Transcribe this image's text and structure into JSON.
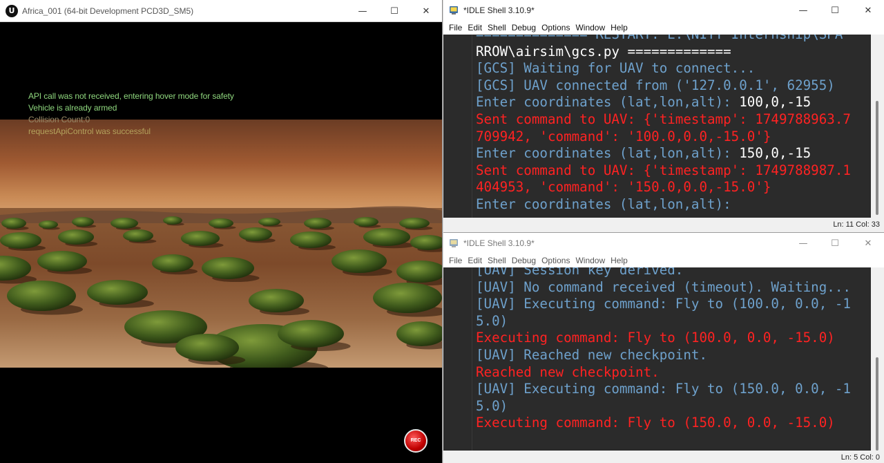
{
  "unreal": {
    "window_title": "Africa_001 (64-bit Development PCD3D_SM5)",
    "logo_glyph": "U",
    "controls": {
      "minimize": "—",
      "maximize": "☐",
      "close": "✕"
    },
    "messages": [
      "API call was not received, entering hover mode for safety",
      "Vehicle is already armed",
      "Collision Count:0",
      "requestApiControl was successful"
    ],
    "record_button_label": "REC"
  },
  "idle_top": {
    "window_title": "*IDLE Shell 3.10.9*",
    "menu": [
      "File",
      "Edit",
      "Shell",
      "Debug",
      "Options",
      "Window",
      "Help"
    ],
    "lines": [
      [
        {
          "text": "============== RESTART: E:\\NITT Internship\\SPA",
          "style": "out"
        }
      ],
      [
        {
          "text": "RROW\\airsim\\gcs.py =============",
          "style": "in"
        }
      ],
      [
        {
          "text": "[GCS] Waiting for UAV to connect...",
          "style": "out"
        }
      ],
      [
        {
          "text": "[GCS] UAV connected from ('127.0.0.1', 62955)",
          "style": "out"
        }
      ],
      [
        {
          "text": "Enter coordinates (lat,lon,alt): ",
          "style": "out"
        },
        {
          "text": "100,0,-15",
          "style": "in"
        }
      ],
      [
        {
          "text": "Sent command to UAV: {'timestamp': 1749788963.7",
          "style": "err"
        }
      ],
      [
        {
          "text": "709942, 'command': '100.0,0.0,-15.0'}",
          "style": "err"
        }
      ],
      [
        {
          "text": "Enter coordinates (lat,lon,alt): ",
          "style": "out"
        },
        {
          "text": "150,0,-15",
          "style": "in"
        }
      ],
      [
        {
          "text": "Sent command to UAV: {'timestamp': 1749788987.1",
          "style": "err"
        }
      ],
      [
        {
          "text": "404953, 'command': '150.0,0.0,-15.0'}",
          "style": "err"
        }
      ],
      [
        {
          "text": "Enter coordinates (lat,lon,alt):",
          "style": "out"
        }
      ]
    ],
    "status": "Ln: 11   Col: 33"
  },
  "idle_bottom": {
    "window_title": "*IDLE Shell 3.10.9*",
    "menu": [
      "File",
      "Edit",
      "Shell",
      "Debug",
      "Options",
      "Window",
      "Help"
    ],
    "lines": [
      [
        {
          "text": "[UAV] Session key derived.",
          "style": "out"
        }
      ],
      [
        {
          "text": "[UAV] No command received (timeout). Waiting...",
          "style": "out"
        }
      ],
      [
        {
          "text": "[UAV] Executing command: Fly to (100.0, 0.0, -1",
          "style": "out"
        }
      ],
      [
        {
          "text": "5.0)",
          "style": "out"
        }
      ],
      [
        {
          "text": "Executing command: Fly to (100.0, 0.0, -15.0)",
          "style": "err"
        }
      ],
      [
        {
          "text": "[UAV] Reached new checkpoint.",
          "style": "out"
        }
      ],
      [
        {
          "text": "Reached new checkpoint.",
          "style": "err"
        }
      ],
      [
        {
          "text": "[UAV] Executing command: Fly to (150.0, 0.0, -1",
          "style": "out"
        }
      ],
      [
        {
          "text": "5.0)",
          "style": "out"
        }
      ],
      [
        {
          "text": "Executing command: Fly to (150.0, 0.0, -15.0)",
          "style": "err"
        }
      ]
    ],
    "status": "Ln: 5   Col: 0"
  },
  "colors": {
    "shell_output": "#6ea1cc",
    "shell_input": "#ffffff",
    "shell_error": "#ff2222",
    "shell_background": "#2b2b2b",
    "hud_green": "#8fd77e",
    "record_red": "#c00000"
  },
  "icons": [
    "unreal-logo-icon",
    "idle-python-icon",
    "minimize-icon",
    "maximize-icon",
    "close-icon",
    "record-icon"
  ]
}
